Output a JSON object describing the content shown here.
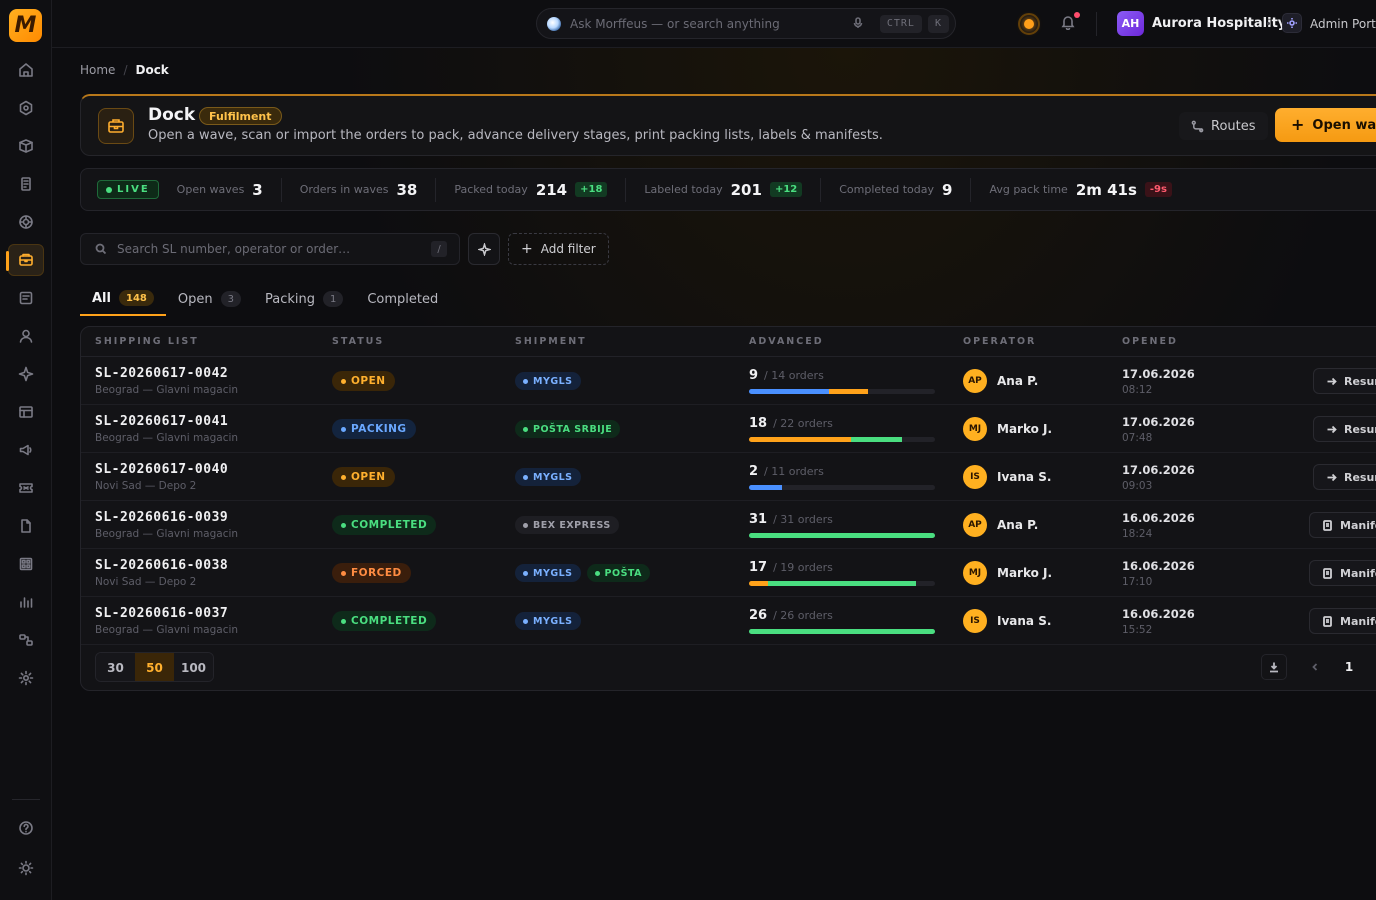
{
  "topbar": {
    "search_placeholder": "Ask Morffeus — or search anything",
    "kbd_ctrl": "CTRL",
    "kbd_k": "K",
    "org_initials": "AH",
    "org_name": "Aurora Hospitality",
    "admin_label": "Admin Portal"
  },
  "breadcrumb": {
    "home": "Home",
    "sep": "/",
    "current": "Dock"
  },
  "hero": {
    "title": "Dock",
    "tag": "Fulfilment",
    "description": "Open a wave, scan or import the orders to pack, advance delivery stages, print packing lists, labels & manifests.",
    "routes_label": "Routes",
    "open_wave_label": "Open wave"
  },
  "stats": {
    "live": "LIVE",
    "items": [
      {
        "label": "Open waves",
        "value": "3",
        "delta": ""
      },
      {
        "label": "Orders in waves",
        "value": "38",
        "delta": ""
      },
      {
        "label": "Packed today",
        "value": "214",
        "delta": "+18"
      },
      {
        "label": "Labeled today",
        "value": "201",
        "delta": "+12"
      },
      {
        "label": "Completed today",
        "value": "9",
        "delta": ""
      },
      {
        "label": "Avg pack time",
        "value": "2m 41s",
        "delta": "-9s"
      }
    ]
  },
  "filters": {
    "search_placeholder": "Search SL number, operator or order…",
    "search_kbd": "/",
    "add_filter_label": "Add filter"
  },
  "tabs": [
    {
      "label": "All",
      "count": "148"
    },
    {
      "label": "Open",
      "count": "3"
    },
    {
      "label": "Packing",
      "count": "1"
    },
    {
      "label": "Completed",
      "count": ""
    }
  ],
  "table": {
    "columns": [
      "Shipping list",
      "Status",
      "Shipment",
      "Advanced",
      "Operator",
      "Opened"
    ],
    "rows": [
      {
        "sl": "SL-20260617-0042",
        "loc": "Beograd — Glavni magacin",
        "status": "OPEN",
        "status_class": "b-open",
        "shipments": [
          {
            "name": "MYGLS",
            "cls": "s-blue"
          }
        ],
        "adv": "9",
        "adv_of": "/ 14 orders",
        "segs": [
          {
            "from": 0,
            "to": 0.43,
            "color": "#4a90ff"
          },
          {
            "from": 0.43,
            "to": 0.64,
            "color": "#ffa21a"
          }
        ],
        "op_initials": "AP",
        "op_name": "Ana P.",
        "date": "17.06.2026",
        "time": "08:12",
        "action": "Resume",
        "action_icon": "arrow"
      },
      {
        "sl": "SL-20260617-0041",
        "loc": "Beograd — Glavni magacin",
        "status": "PACKING",
        "status_class": "b-packing",
        "shipments": [
          {
            "name": "POŠTA SRBIJE",
            "cls": "s-green"
          }
        ],
        "adv": "18",
        "adv_of": "/ 22 orders",
        "segs": [
          {
            "from": 0,
            "to": 0.55,
            "color": "#ffa21a"
          },
          {
            "from": 0.55,
            "to": 0.82,
            "color": "#4ade80"
          }
        ],
        "op_initials": "MJ",
        "op_name": "Marko J.",
        "date": "17.06.2026",
        "time": "07:48",
        "action": "Resume",
        "action_icon": "arrow"
      },
      {
        "sl": "SL-20260617-0040",
        "loc": "Novi Sad — Depo 2",
        "status": "OPEN",
        "status_class": "b-open",
        "shipments": [
          {
            "name": "MYGLS",
            "cls": "s-blue"
          }
        ],
        "adv": "2",
        "adv_of": "/ 11 orders",
        "segs": [
          {
            "from": 0,
            "to": 0.18,
            "color": "#4a90ff"
          }
        ],
        "op_initials": "IS",
        "op_name": "Ivana S.",
        "date": "17.06.2026",
        "time": "09:03",
        "action": "Resume",
        "action_icon": "arrow"
      },
      {
        "sl": "SL-20260616-0039",
        "loc": "Beograd — Glavni magacin",
        "status": "COMPLETED",
        "status_class": "b-completed",
        "shipments": [
          {
            "name": "BEX EXPRESS",
            "cls": "s-gray"
          }
        ],
        "adv": "31",
        "adv_of": "/ 31 orders",
        "segs": [
          {
            "from": 0,
            "to": 1,
            "color": "#4ade80"
          }
        ],
        "op_initials": "AP",
        "op_name": "Ana P.",
        "date": "16.06.2026",
        "time": "18:24",
        "action": "Manifest",
        "action_icon": "doc"
      },
      {
        "sl": "SL-20260616-0038",
        "loc": "Novi Sad — Depo 2",
        "status": "FORCED",
        "status_class": "b-forced",
        "shipments": [
          {
            "name": "MYGLS",
            "cls": "s-blue"
          },
          {
            "name": "POŠTA",
            "cls": "s-green"
          }
        ],
        "adv": "17",
        "adv_of": "/ 19 orders",
        "segs": [
          {
            "from": 0,
            "to": 0.1,
            "color": "#ffa21a"
          },
          {
            "from": 0.1,
            "to": 0.9,
            "color": "#4ade80"
          }
        ],
        "op_initials": "MJ",
        "op_name": "Marko J.",
        "date": "16.06.2026",
        "time": "17:10",
        "action": "Manifest",
        "action_icon": "doc"
      },
      {
        "sl": "SL-20260616-0037",
        "loc": "Beograd — Glavni magacin",
        "status": "COMPLETED",
        "status_class": "b-completed",
        "shipments": [
          {
            "name": "MYGLS",
            "cls": "s-blue"
          }
        ],
        "adv": "26",
        "adv_of": "/ 26 orders",
        "segs": [
          {
            "from": 0,
            "to": 1,
            "color": "#4ade80"
          }
        ],
        "op_initials": "IS",
        "op_name": "Ivana S.",
        "date": "16.06.2026",
        "time": "15:52",
        "action": "Manifest",
        "action_icon": "doc"
      }
    ]
  },
  "pagination": {
    "sizes": [
      "30",
      "50",
      "100"
    ],
    "active_size": "50",
    "current_page": "1"
  }
}
